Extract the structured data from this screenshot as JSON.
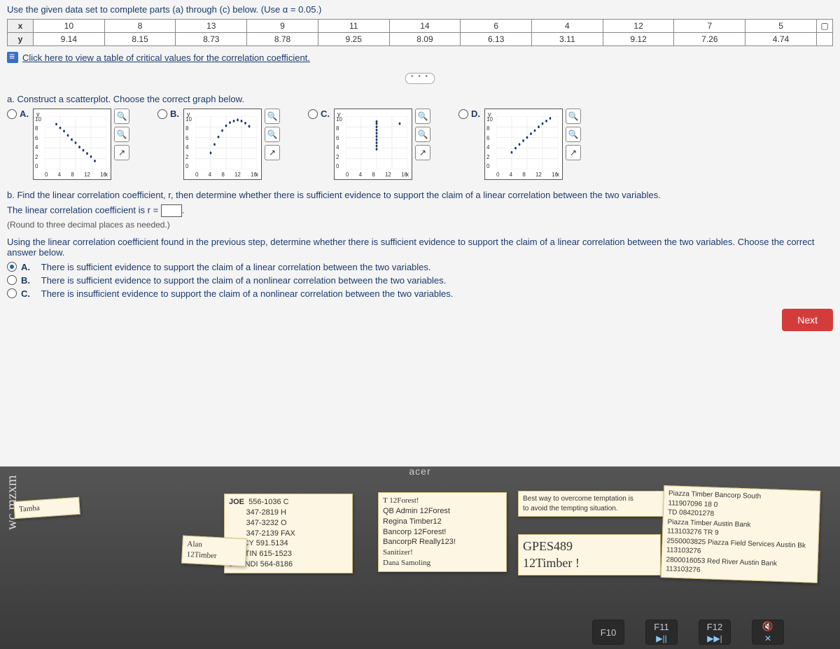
{
  "prompt": "Use the given data set to complete parts (a) through (c) below. (Use α = 0.05.)",
  "row_header_x": "x",
  "row_header_y": "y",
  "data_x": [
    "10",
    "8",
    "13",
    "9",
    "11",
    "14",
    "6",
    "4",
    "12",
    "7",
    "5"
  ],
  "data_y": [
    "9.14",
    "8.15",
    "8.73",
    "8.78",
    "9.25",
    "8.09",
    "6.13",
    "3.11",
    "9.12",
    "7.26",
    "4.74"
  ],
  "link": {
    "text": "Click here to view a table of critical values for the correlation coefficient."
  },
  "q_a": "a. Construct a scatterplot. Choose the correct graph below.",
  "options": [
    "A.",
    "B.",
    "C.",
    "D."
  ],
  "axis": {
    "y_label": "y",
    "x_label": "x",
    "y_ticks": [
      "10",
      "8",
      "6",
      "4",
      "2",
      "0"
    ],
    "x_ticks": [
      "0",
      "4",
      "8",
      "12",
      "16"
    ]
  },
  "q_b": "b. Find the linear correlation coefficient, r, then determine whether there is sufficient evidence to support the claim of a linear correlation between the two variables.",
  "r_line_prefix": "The linear correlation coefficient is r = ",
  "round_note": "(Round to three decimal places as needed.)",
  "q_b2": "Using the linear correlation coefficient found in the previous step, determine whether there is sufficient evidence to support the claim of a linear correlation between the two variables. Choose the correct answer below.",
  "mc": {
    "A": "There is sufficient evidence to support the claim of a linear correlation between the two variables.",
    "B": "There is sufficient evidence to support the claim of a nonlinear correlation between the two variables.",
    "C": "There is insufficient evidence to support the claim of a nonlinear correlation between the two variables."
  },
  "next_label": "Next",
  "bezel_brand": "acer",
  "side_text": "wc mzxm",
  "sticky1": "Tamba",
  "sticky2": {
    "title": "JOE",
    "l1": "556-1036 C",
    "l2": "347-2819 H",
    "l3": "347-3232 O",
    "l4": "347-2139 FAX",
    "l5": "STACY 591.5134",
    "l6": "AUSTIN 615-1523",
    "l7": "BRANDI 564-8186"
  },
  "sticky2b": {
    "l1": "Alan",
    "l2": "12Timber"
  },
  "sticky3": {
    "l1": "T 12Forest!",
    "l2": "QB Admin 12Forest",
    "l3": "Regina Timber12",
    "l4": "Bancorp 12Forest!",
    "l5": "BancorpR Really123!",
    "l6": "Sanitizer!",
    "l7": "Dana Samoling"
  },
  "sticky4": {
    "l1": "Best way to overcome temptation is",
    "l2": "to avoid the tempting situation."
  },
  "sticky5": {
    "l1": "GPES489",
    "l2": "12Timber !"
  },
  "sticky6": {
    "l1": "Piazza Timber Bancorp South",
    "l2": "111907096 18 0",
    "l3": "TD 084201278",
    "l4": "Piazza Timber Austin Bank",
    "l5": "113103276 TR 9",
    "l6": "2550003825 Piazza Field Services Austin Bk",
    "l7": "113103276",
    "l8": "2800016053 Red River Austin Bank",
    "l9": "113103276"
  },
  "fkeys": {
    "f10": "F10",
    "f11": "F11",
    "f12": "F12",
    "sym11": "▶||",
    "sym12": "▶▶|",
    "mute": "✕"
  },
  "chart_data": [
    {
      "type": "scatter",
      "option": "A",
      "xlabel": "x",
      "ylabel": "y",
      "xlim": [
        0,
        16
      ],
      "ylim": [
        0,
        10
      ],
      "points": [
        [
          3,
          8.5
        ],
        [
          4,
          7.8
        ],
        [
          5,
          7.2
        ],
        [
          6,
          6.4
        ],
        [
          7,
          5.6
        ],
        [
          8,
          5.0
        ],
        [
          9,
          4.2
        ],
        [
          10,
          3.6
        ],
        [
          11,
          3.0
        ],
        [
          12,
          2.4
        ],
        [
          13,
          1.6
        ]
      ]
    },
    {
      "type": "scatter",
      "option": "B",
      "xlabel": "x",
      "ylabel": "y",
      "xlim": [
        0,
        16
      ],
      "ylim": [
        0,
        10
      ],
      "points": [
        [
          4,
          3.1
        ],
        [
          5,
          4.7
        ],
        [
          6,
          6.1
        ],
        [
          7,
          7.3
        ],
        [
          8,
          8.2
        ],
        [
          9,
          8.8
        ],
        [
          10,
          9.1
        ],
        [
          11,
          9.3
        ],
        [
          12,
          9.1
        ],
        [
          13,
          8.7
        ],
        [
          14,
          8.1
        ]
      ]
    },
    {
      "type": "scatter",
      "option": "C",
      "xlabel": "x",
      "ylabel": "y",
      "xlim": [
        0,
        16
      ],
      "ylim": [
        0,
        10
      ],
      "points": [
        [
          8,
          5.0
        ],
        [
          8,
          5.6
        ],
        [
          8,
          6.2
        ],
        [
          8,
          6.8
        ],
        [
          8,
          7.4
        ],
        [
          8,
          8.0
        ],
        [
          8,
          8.6
        ],
        [
          8,
          9.0
        ],
        [
          8,
          4.4
        ],
        [
          8,
          3.8
        ],
        [
          14,
          8.6
        ]
      ]
    },
    {
      "type": "scatter",
      "option": "D",
      "xlabel": "x",
      "ylabel": "y",
      "xlim": [
        0,
        16
      ],
      "ylim": [
        0,
        10
      ],
      "points": [
        [
          4,
          3.2
        ],
        [
          5,
          4.0
        ],
        [
          6,
          4.7
        ],
        [
          7,
          5.4
        ],
        [
          8,
          6.0
        ],
        [
          9,
          6.7
        ],
        [
          10,
          7.3
        ],
        [
          11,
          8.0
        ],
        [
          12,
          8.6
        ],
        [
          13,
          9.1
        ],
        [
          14,
          9.6
        ]
      ]
    }
  ]
}
